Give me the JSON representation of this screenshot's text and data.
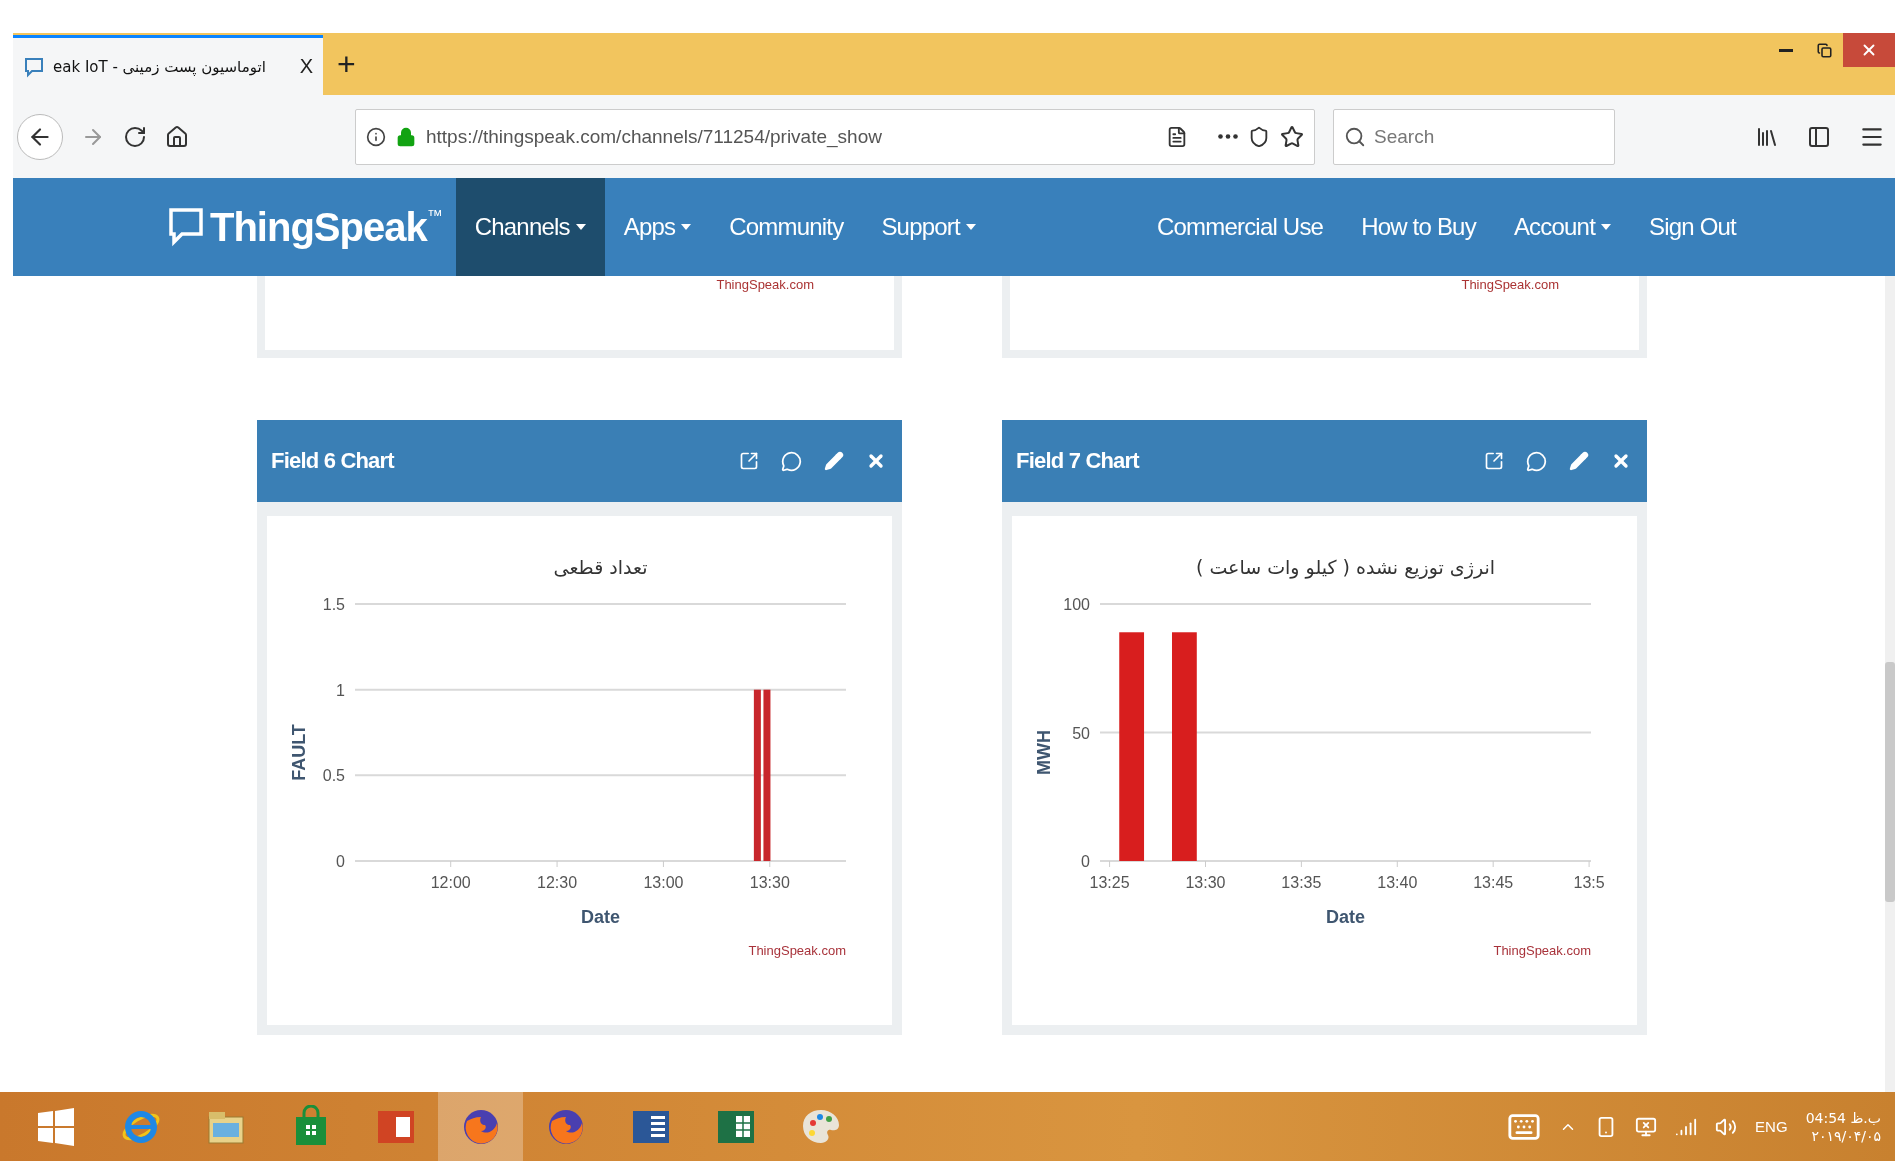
{
  "browser": {
    "tabs": [
      {
        "title": "اتوماسیون پست زمینی - eak IoT",
        "close": "X",
        "selected": true
      }
    ],
    "new_tab": "+",
    "url": "https://thingspeak.com/channels/711254/private_show",
    "search": {
      "placeholder": "Search"
    }
  },
  "navbar": {
    "logo": "ThingSpeak$^{™}$",
    "left_items": [
      {
        "label": "Channels",
        "dropdown": true,
        "selected": true
      },
      {
        "label": "Apps",
        "dropdown": true,
        "selected": false
      },
      {
        "label": "Community",
        "dropdown": false,
        "selected": false
      },
      {
        "label": "Support",
        "dropdown": true,
        "selected": false
      }
    ],
    "right_items": [
      {
        "label": "Commercial Use",
        "dropdown": false,
        "selected": false
      },
      {
        "label": "How to Buy",
        "dropdown": false,
        "selected": false
      },
      {
        "label": "Account",
        "dropdown": true,
        "selected": false
      },
      {
        "label": "Sign Out",
        "dropdown": false,
        "selected": false
      }
    ]
  },
  "top_cards": [
    {
      "credit": "ThingSpeak.com"
    },
    {
      "credit": "ThingSpeak.com"
    }
  ],
  "cards": [
    {
      "title": "Field 6 Chart",
      "credit": "ThingSpeak.com",
      "chart_data": {
        "type": "bar",
        "title": "تعداد قطعی",
        "xlabel": "Date",
        "ylabel": "FAULT",
        "x": [
          806.5,
          809.2
        ],
        "series": [
          {
            "color": "#c8262c",
            "values": [
              1,
              1
            ]
          }
        ],
        "xlim": [
          693,
          831.5
        ],
        "ylim": [
          0,
          1.5
        ],
        "xticks": [
          {
            "value": 720,
            "label": "12:00"
          },
          {
            "value": 750,
            "label": "12:30"
          },
          {
            "value": 780,
            "label": "13:00"
          },
          {
            "value": 810,
            "label": "13:30"
          }
        ],
        "yticks": [
          0,
          0.5,
          1,
          1.5
        ]
      }
    },
    {
      "title": "Field 7 Chart",
      "credit": "ThingSpeak.com",
      "chart_data": {
        "type": "bar",
        "title": "انرژی توزیع نشده ( کیلو وات ساعت )",
        "xlabel": "Date",
        "ylabel": "MWH",
        "x": [
          806.15,
          808.9
        ],
        "series": [
          {
            "color": "#d81e1e",
            "values": [
              89,
              89
            ]
          }
        ],
        "xlim": [
          804.5,
          830.1
        ],
        "ylim": [
          0,
          100
        ],
        "xticks": [
          {
            "value": 805,
            "label": "13:25"
          },
          {
            "value": 810,
            "label": "13:30"
          },
          {
            "value": 815,
            "label": "13:35"
          },
          {
            "value": 820,
            "label": "13:40"
          },
          {
            "value": 825,
            "label": "13:45"
          },
          {
            "value": 830,
            "label": "13:5"
          }
        ],
        "yticks": [
          0,
          50,
          100
        ]
      }
    }
  ],
  "taskbar": {
    "apps": [
      {
        "kind": "start",
        "selected": false
      },
      {
        "kind": "ie",
        "selected": false
      },
      {
        "kind": "explorer",
        "selected": false
      },
      {
        "kind": "store",
        "selected": false
      },
      {
        "kind": "slides",
        "selected": false
      },
      {
        "kind": "firefox",
        "selected": true
      },
      {
        "kind": "firefox",
        "selected": false
      },
      {
        "kind": "word",
        "selected": false
      },
      {
        "kind": "sheet",
        "selected": false
      },
      {
        "kind": "paint",
        "selected": false
      }
    ],
    "language": "ENG",
    "time": "04:54 ب.ظ",
    "date": "۲۰۱۹/۰۴/۰۵"
  }
}
